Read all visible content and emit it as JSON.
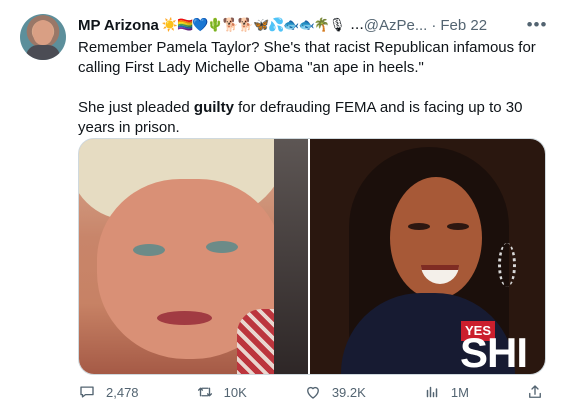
{
  "tweet": {
    "author": {
      "display_name": "MP Arizona",
      "emoji_string": "☀️🏳️‍🌈💙🌵🐕🐕🦋💦🐟🐟🌴🎙",
      "truncation": "...",
      "handle": "@AzPe...",
      "separator": "·",
      "date": "Feb 22",
      "more": "•••"
    },
    "text": {
      "paragraph1": "Remember Pamela Taylor? She's that racist Republican infamous for calling First Lady Michelle Obama \"an ape in heels.\"",
      "paragraph2_start": "She just pleaded ",
      "paragraph2_bold": "guilty",
      "paragraph2_end": " for defrauding FEMA and is facing up to 30 years in prison."
    },
    "media": {
      "right_badge": "YES",
      "right_text": "SHI"
    },
    "actions": {
      "replies": "2,478",
      "retweets": "10K",
      "likes": "39.2K",
      "views": "1M"
    }
  },
  "icons": {
    "reply": "speech-bubble-icon",
    "retweet": "retweet-arrows-icon",
    "like": "heart-icon",
    "views": "bar-chart-icon",
    "share": "share-upload-icon",
    "more": "more-dots-icon"
  },
  "colors": {
    "text": "#0f1419",
    "secondary": "#536471",
    "border": "#cfd9de",
    "badge": "#cb1f2d"
  }
}
